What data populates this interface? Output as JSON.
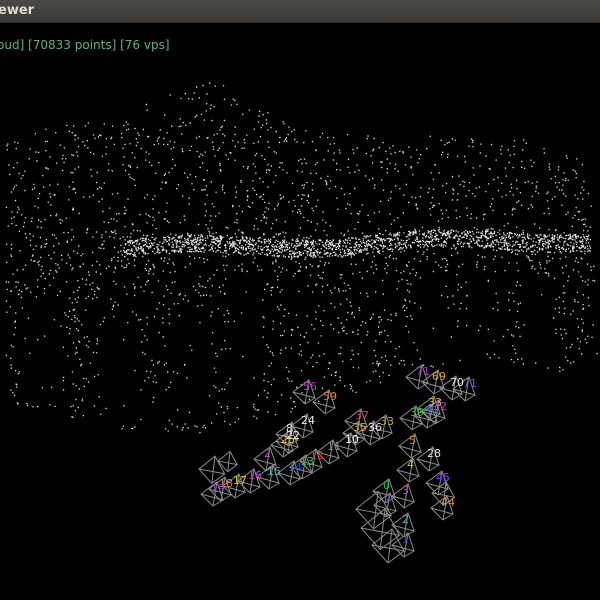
{
  "window": {
    "title": "ewer"
  },
  "status": {
    "text": "oud] [70833 points] [76 vps]"
  },
  "camera_labels": [
    {
      "text": "71",
      "color": "#a23bd6"
    },
    {
      "text": "69",
      "color": "#e0a020"
    },
    {
      "text": "70",
      "color": "#e6e6e6"
    },
    {
      "text": "71",
      "color": "#5a62e0"
    },
    {
      "text": "56",
      "color": "#c03bd0"
    },
    {
      "text": "59",
      "color": "#e07a2a"
    },
    {
      "text": "33",
      "color": "#e0b040"
    },
    {
      "text": "39",
      "color": "#30c040"
    },
    {
      "text": "31",
      "color": "#4060e0"
    },
    {
      "text": "32",
      "color": "#c040c0"
    },
    {
      "text": "22",
      "color": "#f0f0f0"
    },
    {
      "text": "24",
      "color": "#f0f0f0"
    },
    {
      "text": "25",
      "color": "#e0c030"
    },
    {
      "text": "37",
      "color": "#d04040"
    },
    {
      "text": "35",
      "color": "#e0a030"
    },
    {
      "text": "36",
      "color": "#e0e0e0"
    },
    {
      "text": "33",
      "color": "#c0a040"
    },
    {
      "text": "10",
      "color": "#f0f0f0"
    },
    {
      "text": "11",
      "color": "#808080"
    },
    {
      "text": "12",
      "color": "#d03030"
    },
    {
      "text": "13",
      "color": "#30c050"
    },
    {
      "text": "14",
      "color": "#3050d0"
    },
    {
      "text": "15",
      "color": "#40c0c0"
    },
    {
      "text": "16",
      "color": "#c040c0"
    },
    {
      "text": "17",
      "color": "#e0c030"
    },
    {
      "text": "18",
      "color": "#e08030"
    },
    {
      "text": "19",
      "color": "#8040e0"
    },
    {
      "text": "2",
      "color": "#c050c0"
    },
    {
      "text": "4",
      "color": "#e0c020"
    },
    {
      "text": "0",
      "color": "#30c040"
    },
    {
      "text": "3",
      "color": "#c040c0"
    },
    {
      "text": "7",
      "color": "#4060e0"
    },
    {
      "text": "2",
      "color": "#40c0c0"
    },
    {
      "text": "1",
      "color": "#3040e0"
    },
    {
      "text": "44",
      "color": "#e08030"
    },
    {
      "text": "45",
      "color": "#8040e0"
    },
    {
      "text": "28",
      "color": "#e0e0e0"
    },
    {
      "text": "5",
      "color": "#e08030"
    },
    {
      "text": "8",
      "color": "#e0e0e0"
    }
  ]
}
